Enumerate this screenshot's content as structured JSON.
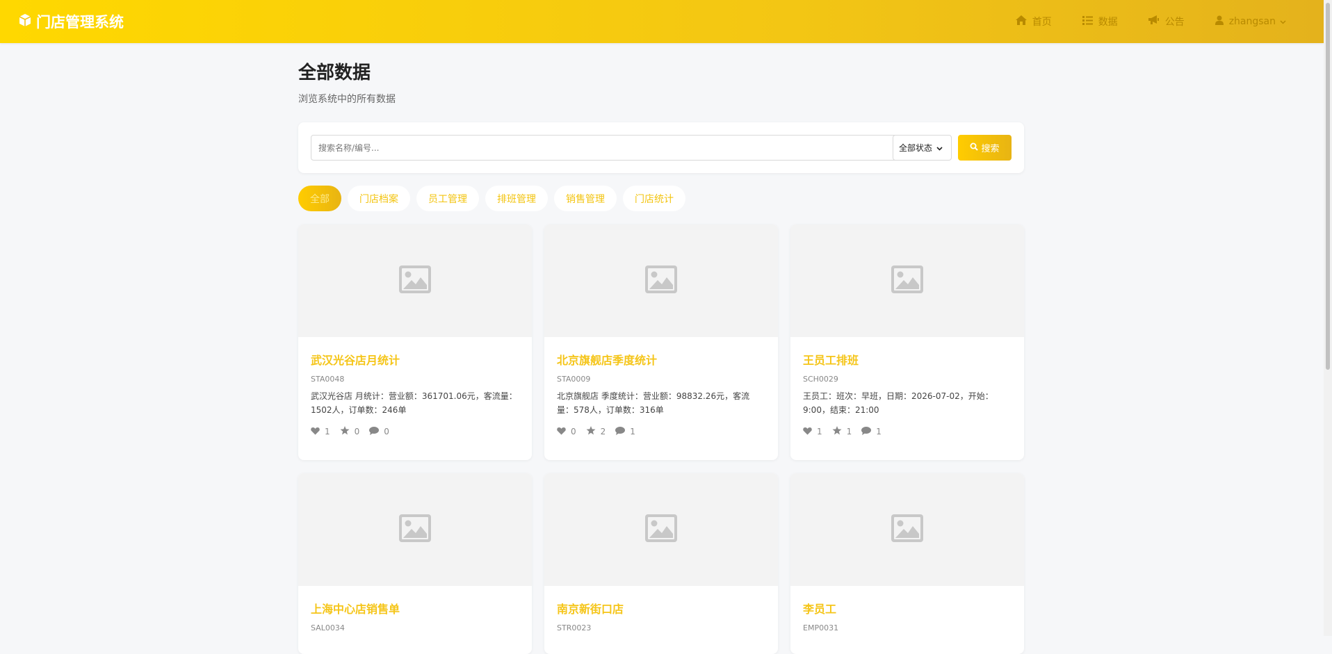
{
  "header": {
    "brand": "门店管理系统",
    "nav": [
      {
        "label": "首页",
        "icon": "home-icon"
      },
      {
        "label": "数据",
        "icon": "list-icon"
      },
      {
        "label": "公告",
        "icon": "megaphone-icon"
      }
    ],
    "user": "zhangsan"
  },
  "page": {
    "title": "全部数据",
    "subtitle": "浏览系统中的所有数据"
  },
  "search": {
    "placeholder": "搜索名称/编号...",
    "status_selected": "全部状态",
    "button_label": "搜索"
  },
  "tabs": [
    "全部",
    "门店档案",
    "员工管理",
    "排班管理",
    "销售管理",
    "门店统计"
  ],
  "cards": [
    {
      "title": "武汉光谷店月统计",
      "code": "STA0048",
      "desc": "武汉光谷店 月统计：营业额：361701.06元，客流量：1502人，订单数：246单",
      "likes": "1",
      "stars": "0",
      "comments": "0"
    },
    {
      "title": "北京旗舰店季度统计",
      "code": "STA0009",
      "desc": "北京旗舰店 季度统计：营业额：98832.26元，客流量：578人，订单数：316单",
      "likes": "0",
      "stars": "2",
      "comments": "1"
    },
    {
      "title": "王员工排班",
      "code": "SCH0029",
      "desc": "王员工：班次：早班，日期：2026-07-02，开始：9:00，结束：21:00",
      "likes": "1",
      "stars": "1",
      "comments": "1"
    },
    {
      "title": "上海中心店销售单",
      "code": "SAL0034",
      "desc": "",
      "likes": "",
      "stars": "",
      "comments": ""
    },
    {
      "title": "南京新街口店",
      "code": "STR0023",
      "desc": "",
      "likes": "",
      "stars": "",
      "comments": ""
    },
    {
      "title": "李员工",
      "code": "EMP0031",
      "desc": "",
      "likes": "",
      "stars": "",
      "comments": ""
    }
  ],
  "colors": {
    "accent": "#f5c518",
    "header_start": "#ffd800",
    "header_end": "#e4b21c",
    "nav_text": "#b88a00"
  }
}
